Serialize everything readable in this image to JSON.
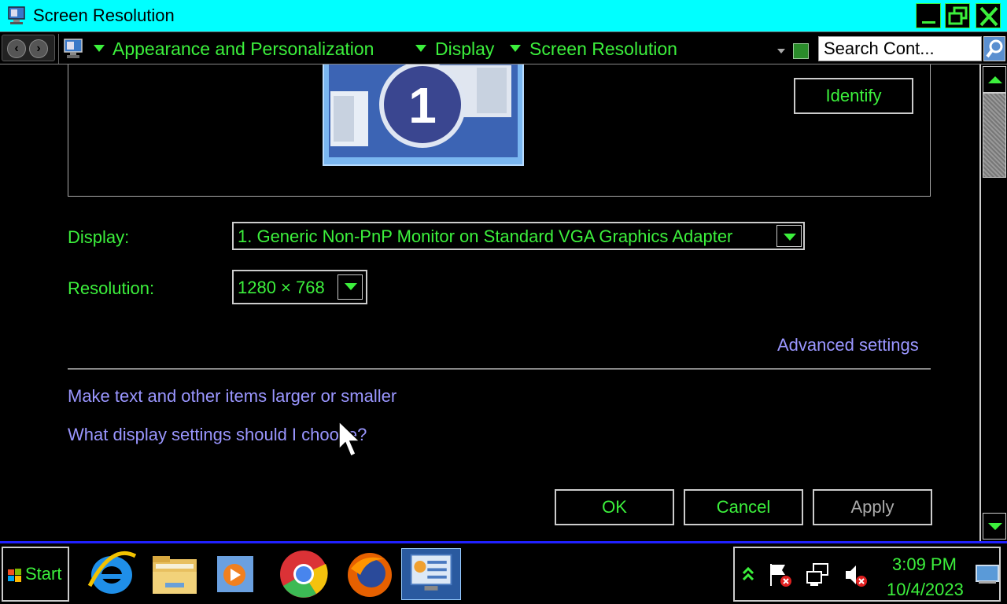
{
  "window": {
    "title": "Screen Resolution"
  },
  "address": {
    "breadcrumbs": [
      "Appearance and Personalization",
      "Display",
      "Screen Resolution"
    ],
    "search_placeholder": "Search Cont..."
  },
  "monitor_preview": {
    "number": "1",
    "identify_label": "Identify"
  },
  "settings": {
    "display_label": "Display:",
    "display_value": "1. Generic Non-PnP Monitor on Standard VGA Graphics Adapter",
    "resolution_label": "Resolution:",
    "resolution_value": "1280 × 768",
    "advanced_link": "Advanced settings"
  },
  "links": {
    "text_size": "Make text and other items larger or smaller",
    "help": "What display settings should I choose?"
  },
  "buttons": {
    "ok": "OK",
    "cancel": "Cancel",
    "apply": "Apply"
  },
  "taskbar": {
    "start_label": "Start",
    "pinned": [
      "internet-explorer-icon",
      "file-explorer-icon",
      "media-player-icon",
      "chrome-icon",
      "firefox-icon",
      "control-panel-icon"
    ],
    "clock_time": "3:09 PM",
    "clock_date": "10/4/2023"
  },
  "colors": {
    "titlebar": "#00ffff",
    "text": "#3cf03c",
    "link": "#9a96ff",
    "taskbar_border": "#2020ff"
  }
}
